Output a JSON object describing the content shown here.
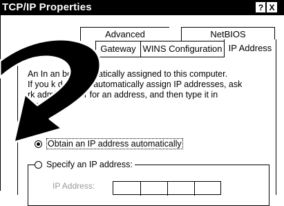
{
  "window": {
    "title": "TCP/IP Properties",
    "help_label": "?",
    "close_label": "X"
  },
  "tabs": {
    "row1": [
      "Advanced",
      "NetBIOS"
    ],
    "row2": [
      "Gateway",
      "WINS Configuration",
      "IP Address"
    ],
    "active": "IP Address"
  },
  "page": {
    "description": "An IP address can be automatically assigned to this computer.\nIf your network does not automatically assign IP addresses, ask\nyour network administrator for an address, and then type it in\nthe space below.",
    "description_visible": "An In      an be automatically assigned to this computer.\nIf you      k does not automatically assign IP addresses, ask\n              rk administrator for an address, and then type it in\n                    elow.",
    "obtain_label": "Obtain an IP address automatically",
    "specify_label": "Specify an IP address:",
    "ip_address_label": "IP Address:",
    "selected_option": "obtain"
  },
  "colors": {
    "title_bar": "#000000",
    "background": "#ffffff",
    "disabled_text": "#999999"
  }
}
